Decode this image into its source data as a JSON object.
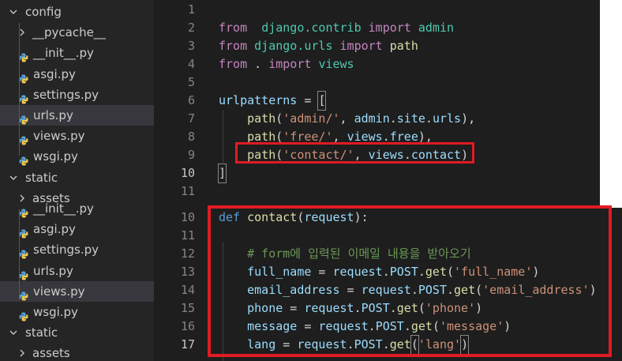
{
  "explorer": {
    "top_section": [
      {
        "label": "config",
        "kind": "folder",
        "state": "open"
      },
      {
        "label": "__pycache__",
        "kind": "folder",
        "state": "closed"
      },
      {
        "label": "__init__.py",
        "kind": "python-file"
      },
      {
        "label": "asgi.py",
        "kind": "python-file"
      },
      {
        "label": "settings.py",
        "kind": "python-file"
      },
      {
        "label": "urls.py",
        "kind": "python-file",
        "selected": true
      },
      {
        "label": "views.py",
        "kind": "python-file"
      },
      {
        "label": "wsgi.py",
        "kind": "python-file"
      },
      {
        "label": "static",
        "kind": "folder",
        "state": "open"
      },
      {
        "label": "assets",
        "kind": "folder",
        "state": "closed"
      }
    ],
    "bottom_section": [
      {
        "label": "__init__.py",
        "kind": "python-file"
      },
      {
        "label": "asgi.py",
        "kind": "python-file"
      },
      {
        "label": "settings.py",
        "kind": "python-file"
      },
      {
        "label": "urls.py",
        "kind": "python-file"
      },
      {
        "label": "views.py",
        "kind": "python-file",
        "selected": true
      },
      {
        "label": "wsgi.py",
        "kind": "python-file"
      },
      {
        "label": "static",
        "kind": "folder",
        "state": "open"
      },
      {
        "label": "assets",
        "kind": "folder",
        "state": "closed"
      }
    ]
  },
  "urls_file": {
    "line_numbers": [
      "1",
      "2",
      "3",
      "4",
      "5",
      "6",
      "7",
      "8",
      "9",
      "10",
      "11"
    ],
    "lines": [
      [],
      [
        [
          "kw",
          "from"
        ],
        [
          "",
          "  "
        ],
        [
          "mod",
          "django.contrib"
        ],
        [
          "",
          ""
        ],
        [
          "kw",
          " import"
        ],
        [
          "",
          " "
        ],
        [
          "mod",
          "admin"
        ]
      ],
      [
        [
          "kw",
          "from"
        ],
        [
          "",
          " "
        ],
        [
          "mod",
          "django.urls"
        ],
        [
          "",
          " "
        ],
        [
          "kw",
          "import"
        ],
        [
          "",
          " "
        ],
        [
          "fn",
          "path"
        ]
      ],
      [
        [
          "kw",
          "from"
        ],
        [
          "",
          " . "
        ],
        [
          "kw",
          "import"
        ],
        [
          "",
          " "
        ],
        [
          "mod",
          "views"
        ]
      ],
      [],
      [
        [
          "var",
          "urlpatterns"
        ],
        [
          "",
          " = "
        ],
        [
          "bracket",
          "["
        ]
      ],
      [
        [
          "",
          " "
        ],
        [
          "fn",
          "path"
        ],
        [
          "",
          "("
        ],
        [
          "str",
          "'admin/'"
        ],
        [
          "",
          ", "
        ],
        [
          "var",
          "admin"
        ],
        [
          "",
          "."
        ],
        [
          "var",
          "site"
        ],
        [
          "",
          "."
        ],
        [
          "var",
          "urls"
        ],
        [
          "",
          "),"
        ]
      ],
      [
        [
          "",
          " "
        ],
        [
          "fn",
          "path"
        ],
        [
          "",
          "("
        ],
        [
          "str",
          "'free/'"
        ],
        [
          "",
          ", "
        ],
        [
          "var",
          "views"
        ],
        [
          "",
          "."
        ],
        [
          "var",
          "free"
        ],
        [
          "",
          "),"
        ]
      ],
      [
        [
          "",
          " "
        ],
        [
          "fn",
          "path"
        ],
        [
          "",
          "("
        ],
        [
          "str",
          "'contact/'"
        ],
        [
          "",
          ", "
        ],
        [
          "var",
          "views"
        ],
        [
          "",
          "."
        ],
        [
          "var",
          "contact"
        ],
        [
          "",
          ")"
        ]
      ],
      [
        [
          "bracket",
          "]"
        ]
      ],
      []
    ]
  },
  "views_file": {
    "line_numbers": [
      "10",
      "11",
      "12",
      "13",
      "14",
      "15",
      "16",
      "17"
    ],
    "lines": [
      [
        [
          "kwb",
          "def"
        ],
        [
          "",
          " "
        ],
        [
          "fn",
          "contact"
        ],
        [
          "",
          "("
        ],
        [
          "var",
          "request"
        ],
        [
          "",
          "):"
        ]
      ],
      [],
      [
        [
          "cm",
          " # form에 입력된 이메일 내용을 받아오기"
        ]
      ],
      [
        [
          "var",
          " full_name"
        ],
        [
          "",
          " = "
        ],
        [
          "var",
          "request"
        ],
        [
          "",
          "."
        ],
        [
          "var",
          "POST"
        ],
        [
          "",
          "."
        ],
        [
          "fn",
          "get"
        ],
        [
          "",
          "("
        ],
        [
          "str",
          "'full_name'"
        ],
        [
          "",
          ")"
        ]
      ],
      [
        [
          "var",
          " email_address"
        ],
        [
          "",
          " = "
        ],
        [
          "var",
          "request"
        ],
        [
          "",
          "."
        ],
        [
          "var",
          "POST"
        ],
        [
          "",
          "."
        ],
        [
          "fn",
          "get"
        ],
        [
          "",
          "("
        ],
        [
          "str",
          "'email_address'"
        ],
        [
          "",
          ")"
        ]
      ],
      [
        [
          "var",
          " phone"
        ],
        [
          "",
          " = "
        ],
        [
          "var",
          "request"
        ],
        [
          "",
          "."
        ],
        [
          "var",
          "POST"
        ],
        [
          "",
          "."
        ],
        [
          "fn",
          "get"
        ],
        [
          "",
          "("
        ],
        [
          "str",
          "'phone'"
        ],
        [
          "",
          ")"
        ]
      ],
      [
        [
          "var",
          " message"
        ],
        [
          "",
          " = "
        ],
        [
          "var",
          "request"
        ],
        [
          "",
          "."
        ],
        [
          "var",
          "POST"
        ],
        [
          "",
          "."
        ],
        [
          "fn",
          "get"
        ],
        [
          "",
          "("
        ],
        [
          "str",
          "'message'"
        ],
        [
          "",
          ")"
        ]
      ],
      [
        [
          "var",
          " lang"
        ],
        [
          "",
          " = "
        ],
        [
          "var",
          "request"
        ],
        [
          "",
          "."
        ],
        [
          "var",
          "POST"
        ],
        [
          "",
          "."
        ],
        [
          "fn",
          "get"
        ],
        [
          "bracket",
          "("
        ],
        [
          "str",
          "'lang'"
        ],
        [
          "bracket",
          ")"
        ]
      ]
    ]
  },
  "colors": {
    "keyword": "#c586c0",
    "module": "#4ec9b0",
    "function": "#dcdcaa",
    "string": "#ce9178",
    "variable": "#9cdcfe",
    "comment": "#6a9955",
    "highlight_box": "#e01b24"
  }
}
